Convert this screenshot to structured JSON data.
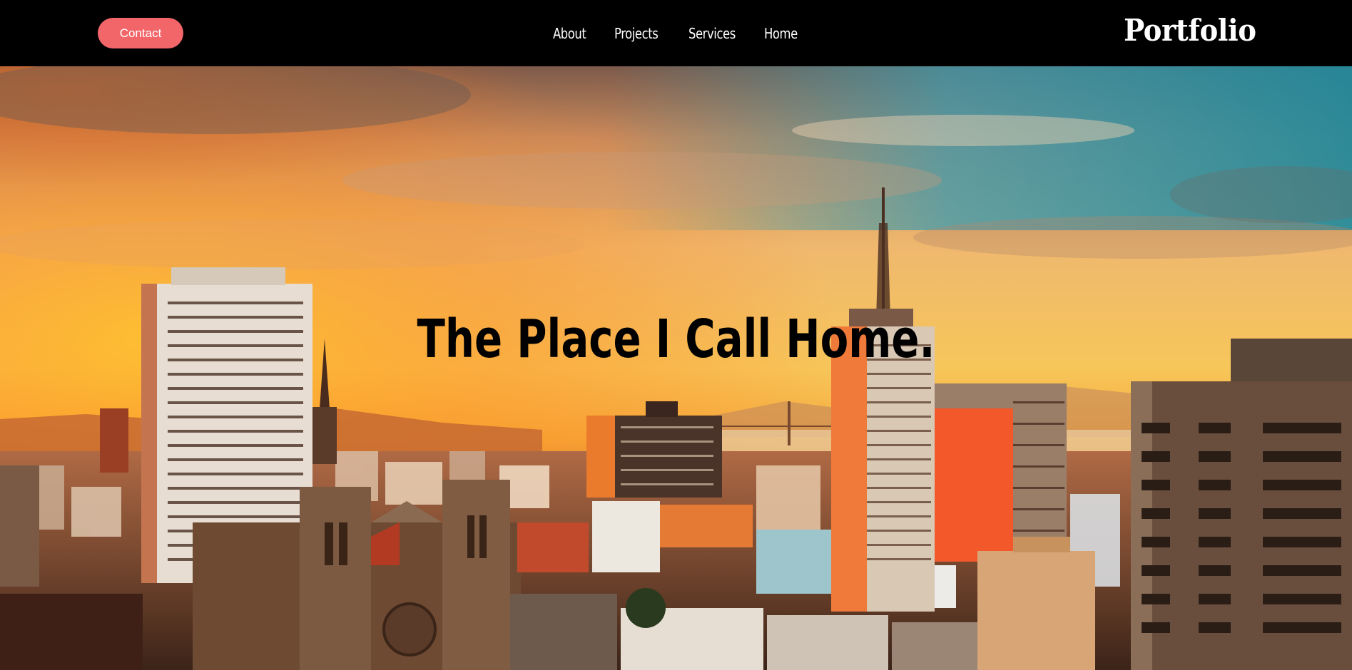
{
  "header": {
    "contact_label": "Contact",
    "nav": [
      {
        "label": "About"
      },
      {
        "label": "Projects"
      },
      {
        "label": "Services"
      },
      {
        "label": "Home"
      }
    ],
    "brand": "Portfolio"
  },
  "hero": {
    "title": "The Place I Call Home."
  },
  "colors": {
    "nav_background": "#000000",
    "contact_button": "#f2666a",
    "nav_text": "#ffffff",
    "hero_title": "#000000"
  }
}
